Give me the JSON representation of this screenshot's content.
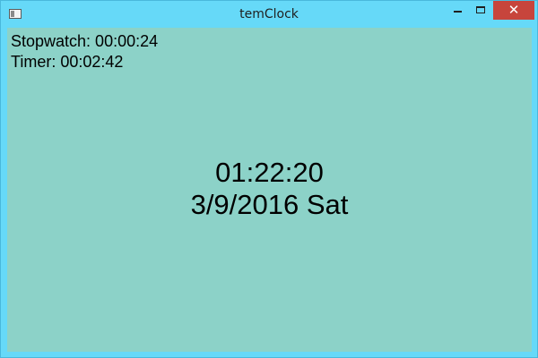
{
  "window": {
    "title": "temClock",
    "controls": {
      "minimize_icon": "minimize-icon",
      "maximize_icon": "maximize-icon",
      "close_label": "✕"
    },
    "colors": {
      "frame": "#66d9f8",
      "client": "#8cd2c8",
      "close": "#c7453c"
    }
  },
  "clock": {
    "stopwatch": "Stopwatch: 00:00:24",
    "timer": "Timer: 00:02:42",
    "time": "01:22:20",
    "date": "3/9/2016 Sat"
  }
}
